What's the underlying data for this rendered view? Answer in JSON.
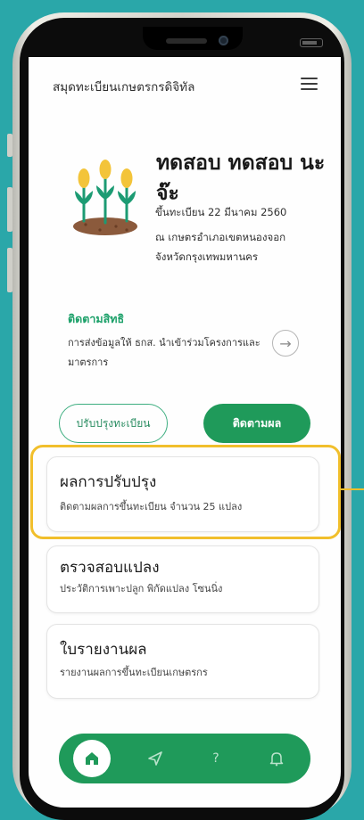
{
  "app": {
    "title": "สมุดทะเบียนเกษตรกรดิจิทัล"
  },
  "profile": {
    "name": "ทดสอบ ทดสอบ นะจ๊ะ",
    "registered": "ขึ้นทะเบียน 22 มีนาคม 2560",
    "location": "ณ เกษตรอำเภอเขตหนองจอก",
    "province": "จังหวัดกรุงเทพมหานคร"
  },
  "tracking": {
    "title": "ติดตามสิทธิ",
    "description": "การส่งข้อมูลให้ ธกส. นำเข้าร่วมโครงการและมาตรการ"
  },
  "actions": {
    "update_label": "ปรับปรุงทะเบียน",
    "track_label": "ติดตามผล"
  },
  "cards": [
    {
      "title": "ผลการปรับปรุง",
      "subtitle": "ติดตามผลการขึ้นทะเบียน จำนวน 25 แปลง"
    },
    {
      "title": "ตรวจสอบแปลง",
      "subtitle": "ประวัติการเพาะปลูก พิกัดแปลง โซนนิ่ง"
    },
    {
      "title": "ใบรายงานผล",
      "subtitle": "รายงานผลการขึ้นทะเบียนเกษตรกร"
    }
  ],
  "nav": {
    "items": [
      "home-icon",
      "send-icon",
      "help-icon",
      "bell-icon"
    ],
    "help_symbol": "?"
  },
  "colors": {
    "background": "#2aa7a9",
    "primary_green": "#1f9a5a",
    "highlight": "#f1bf2c",
    "link_green": "#1da16a"
  }
}
